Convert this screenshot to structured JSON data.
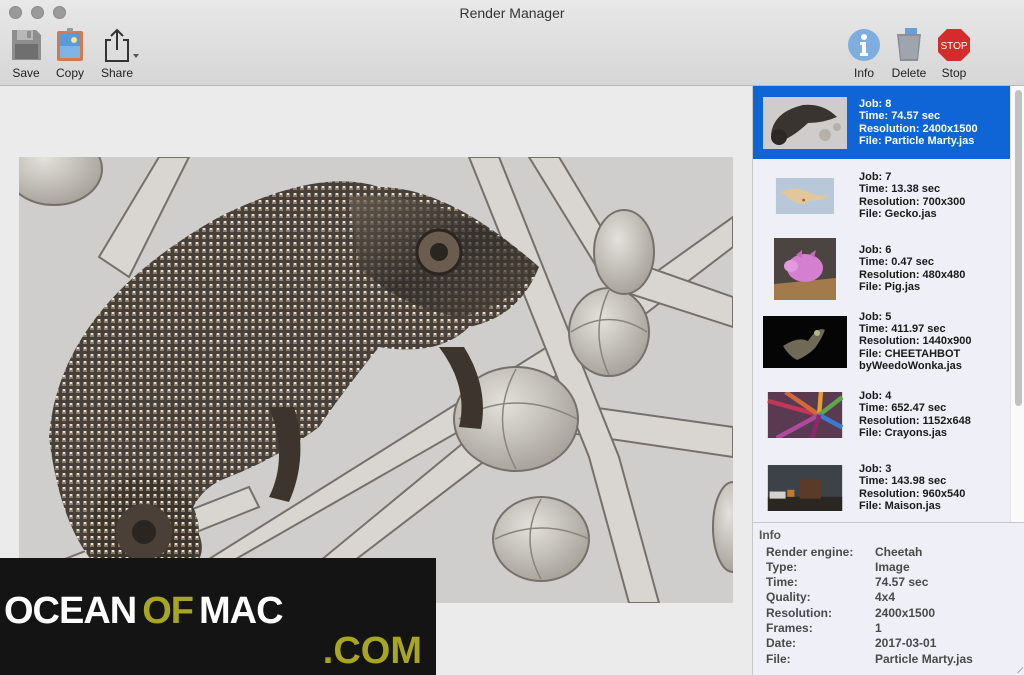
{
  "window": {
    "title": "Render Manager"
  },
  "toolbar": {
    "left": [
      {
        "id": "save",
        "label": "Save",
        "icon": "floppy-disk-icon"
      },
      {
        "id": "copy",
        "label": "Copy",
        "icon": "clipboard-image-icon"
      },
      {
        "id": "share",
        "label": "Share",
        "icon": "share-icon"
      }
    ],
    "right": [
      {
        "id": "info",
        "label": "Info",
        "icon": "info-icon"
      },
      {
        "id": "delete",
        "label": "Delete",
        "icon": "trash-icon"
      },
      {
        "id": "stop",
        "label": "Stop",
        "icon": "stop-sign-icon",
        "icon_text": "STOP"
      }
    ]
  },
  "viewer": {
    "image": "chameleon-render"
  },
  "jobs": [
    {
      "job": "Job: 8",
      "time": "Time: 74.57 sec",
      "resolution": "Resolution: 2400x1500",
      "file": "File: Particle Marty.jas",
      "file2": "",
      "selected": true,
      "thumb": "chameleon"
    },
    {
      "job": "Job: 7",
      "time": "Time: 13.38 sec",
      "resolution": "Resolution: 700x300",
      "file": "File: Gecko.jas",
      "file2": "",
      "selected": false,
      "thumb": "gecko"
    },
    {
      "job": "Job: 6",
      "time": "Time: 0.47 sec",
      "resolution": "Resolution: 480x480",
      "file": "File: Pig.jas",
      "file2": "",
      "selected": false,
      "thumb": "pig"
    },
    {
      "job": "Job: 5",
      "time": "Time: 411.97 sec",
      "resolution": "Resolution: 1440x900",
      "file": "File: CHEETAHBOT",
      "file2": "byWeedoWonka.jas",
      "selected": false,
      "thumb": "cheetahbot"
    },
    {
      "job": "Job: 4",
      "time": "Time: 652.47 sec",
      "resolution": "Resolution: 1152x648",
      "file": "File: Crayons.jas",
      "file2": "",
      "selected": false,
      "thumb": "crayons"
    },
    {
      "job": "Job: 3",
      "time": "Time: 143.98 sec",
      "resolution": "Resolution: 960x540",
      "file": "File: Maison.jas",
      "file2": "",
      "selected": false,
      "thumb": "maison"
    }
  ],
  "info": {
    "title": "Info",
    "rows": [
      {
        "key": "Render engine:",
        "value": "Cheetah"
      },
      {
        "key": "Type:",
        "value": "Image"
      },
      {
        "key": "Time:",
        "value": "74.57 sec"
      },
      {
        "key": "Quality:",
        "value": "4x4"
      },
      {
        "key": "Resolution:",
        "value": "2400x1500"
      },
      {
        "key": "Frames:",
        "value": "1"
      },
      {
        "key": "Date:",
        "value": "2017-03-01"
      },
      {
        "key": "File:",
        "value": "Particle Marty.jas"
      }
    ]
  },
  "watermark": {
    "part1": "OCEAN",
    "part2": "OF",
    "part3": "MAC",
    "part4": ".COM",
    "accent_color": "#a8a523"
  },
  "colors": {
    "selection": "#0f65d6",
    "sidebar_bg": "#eeeff7"
  }
}
